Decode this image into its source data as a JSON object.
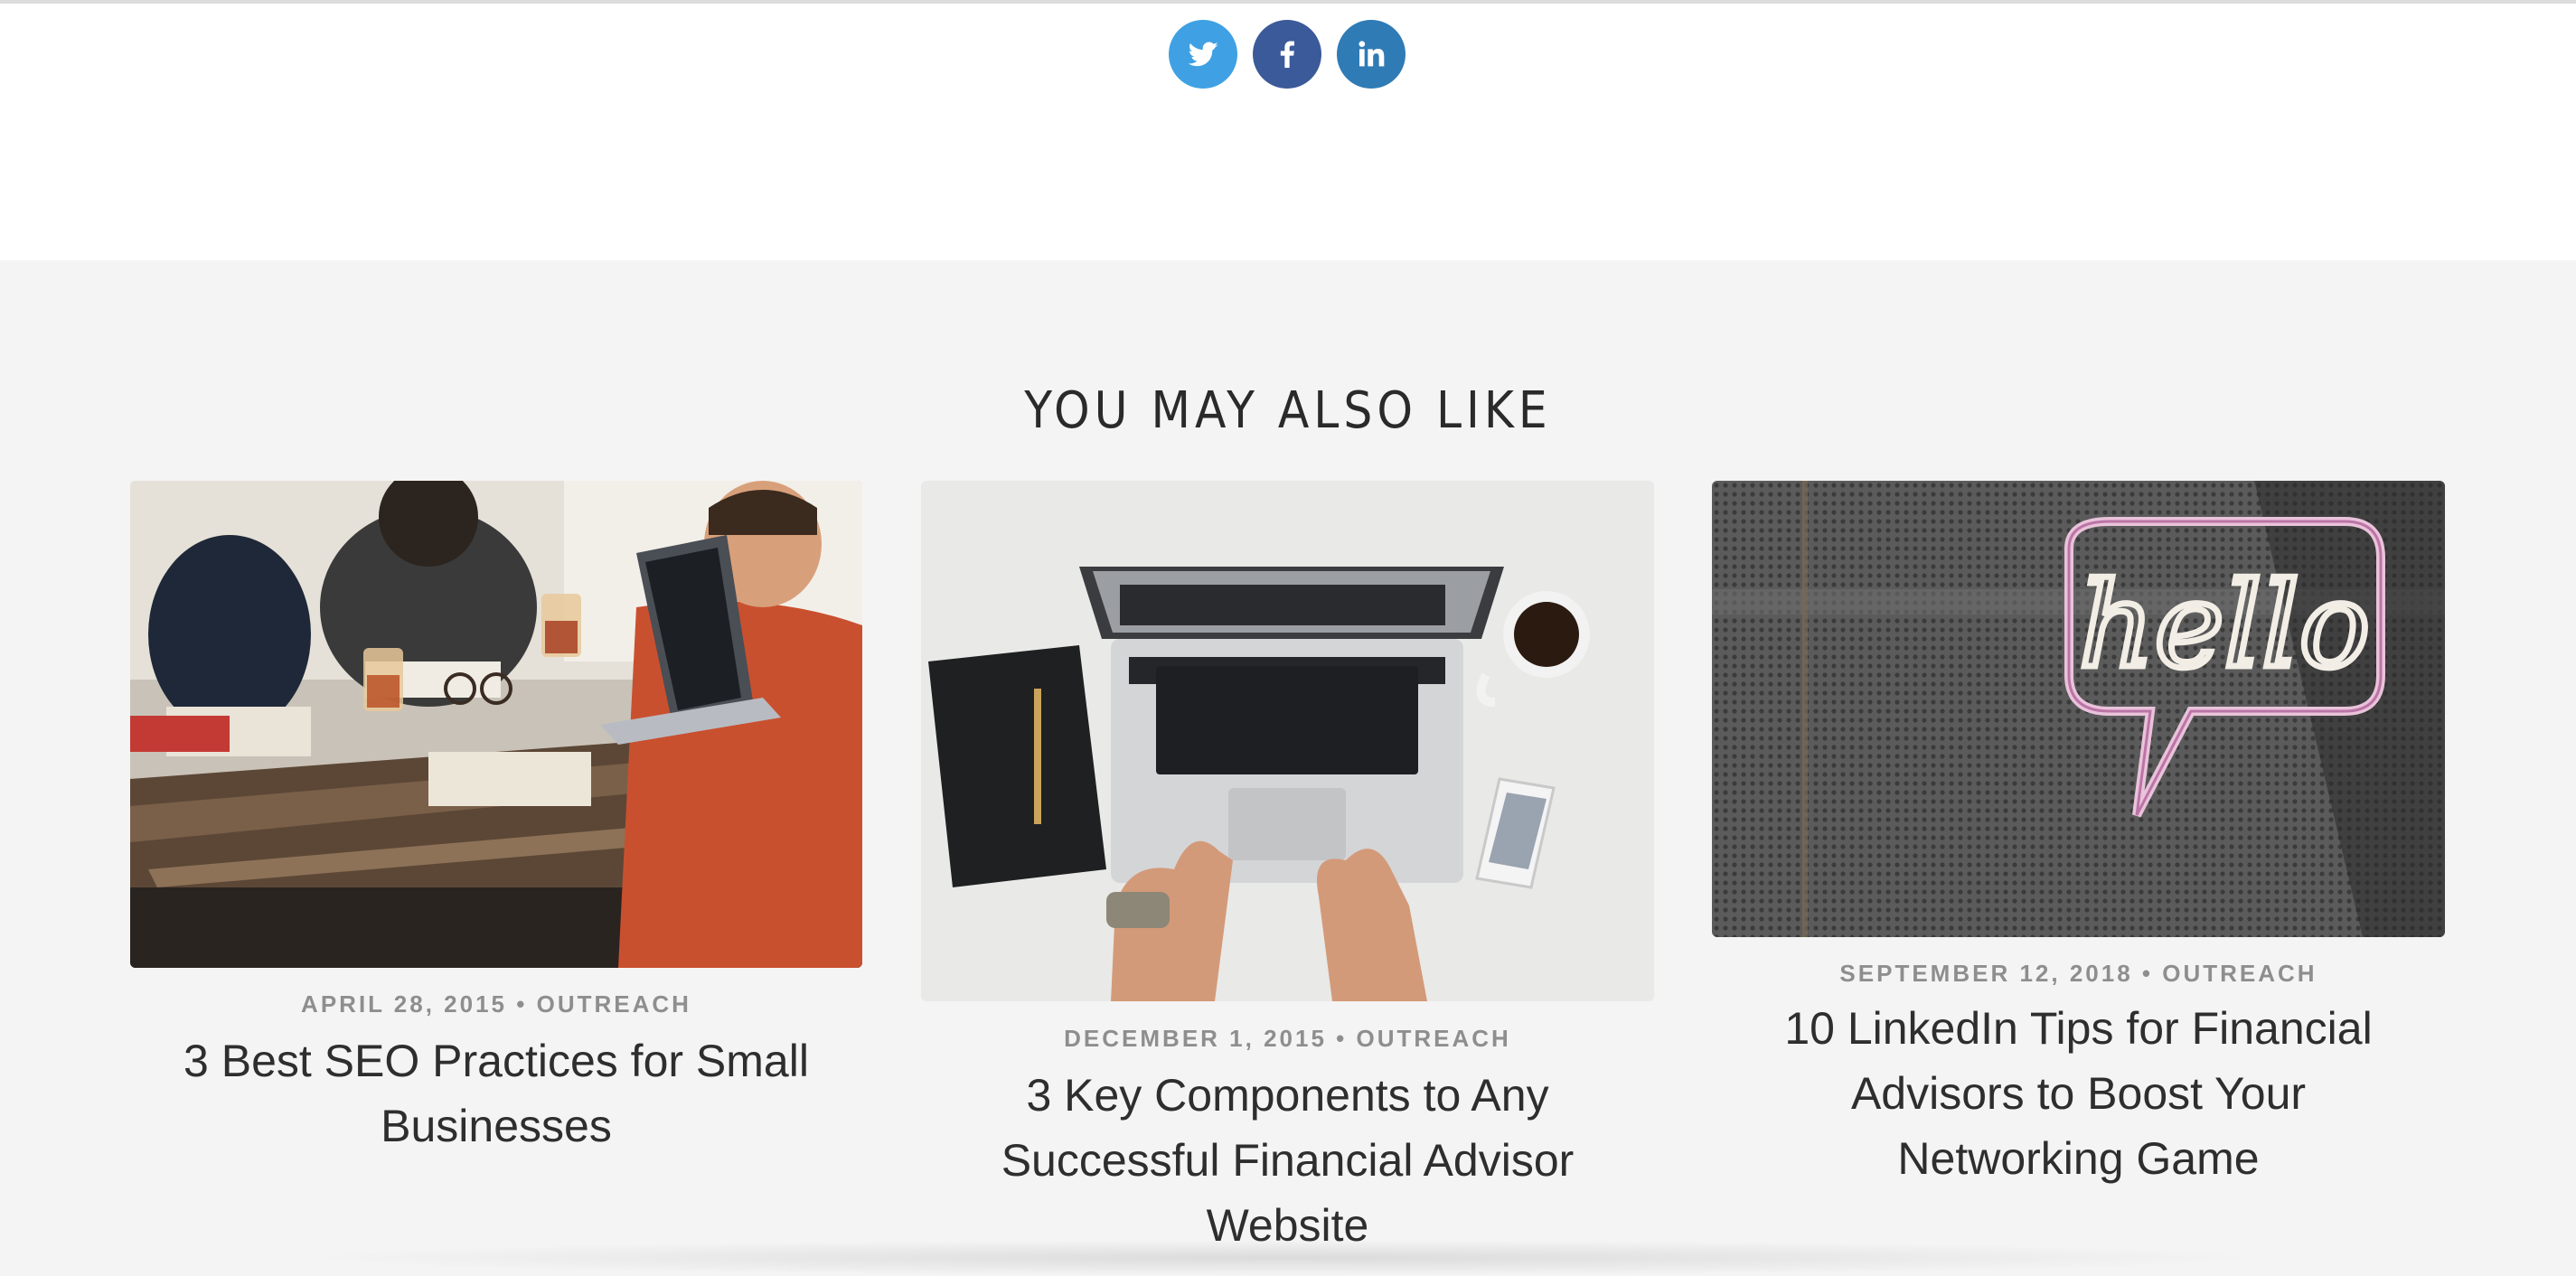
{
  "share": {
    "icons": [
      {
        "name": "twitter-icon",
        "color": "#3fa1e3"
      },
      {
        "name": "facebook-icon",
        "color": "#3b5a99"
      },
      {
        "name": "linkedin-icon",
        "color": "#2f7bb5"
      }
    ]
  },
  "related": {
    "heading": "YOU MAY ALSO LIKE",
    "posts": [
      {
        "date": "APRIL 28, 2015",
        "separator": "•",
        "category": "OUTREACH",
        "title": "3 Best SEO Practices for Small Businesses",
        "image": "team-meeting-photo"
      },
      {
        "date": "DECEMBER 1, 2015",
        "separator": "•",
        "category": "OUTREACH",
        "title": "3 Key Components to Any Successful Financial Advisor Website",
        "image": "laptop-typing-photo"
      },
      {
        "date": "SEPTEMBER 12, 2018",
        "separator": "•",
        "category": "OUTREACH",
        "title": "10 LinkedIn Tips for Financial Advisors to Boost Your Networking Game",
        "image": "hello-neon-sign-photo"
      }
    ]
  }
}
